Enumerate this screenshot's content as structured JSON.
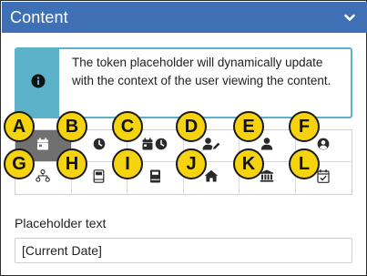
{
  "header": {
    "title": "Content"
  },
  "info": {
    "text": "The token placeholder will dynamically update with the context of the user viewing the content."
  },
  "tokens": [
    {
      "badge": "A",
      "icon": "calendar-icon",
      "selected": true
    },
    {
      "badge": "B",
      "icon": "clock-icon",
      "selected": false
    },
    {
      "badge": "C",
      "icon": "calendar-clock-icon",
      "selected": false
    },
    {
      "badge": "D",
      "icon": "user-edit-icon",
      "selected": false
    },
    {
      "badge": "E",
      "icon": "user-icon",
      "selected": false
    },
    {
      "badge": "F",
      "icon": "user-circle-icon",
      "selected": false
    },
    {
      "badge": "G",
      "icon": "org-chart-icon",
      "selected": false
    },
    {
      "badge": "H",
      "icon": "book-icon",
      "selected": false
    },
    {
      "badge": "I",
      "icon": "book-closed-icon",
      "selected": false
    },
    {
      "badge": "J",
      "icon": "home-icon",
      "selected": false
    },
    {
      "badge": "K",
      "icon": "building-columns-icon",
      "selected": false
    },
    {
      "badge": "L",
      "icon": "calendar-check-icon",
      "selected": false
    }
  ],
  "placeholder": {
    "label": "Placeholder text",
    "value": "[Current Date]"
  },
  "colors": {
    "header": "#3f6fb5",
    "info_accent": "#5cb3c9",
    "badge": "#f5d40f",
    "selected": "#707070"
  }
}
